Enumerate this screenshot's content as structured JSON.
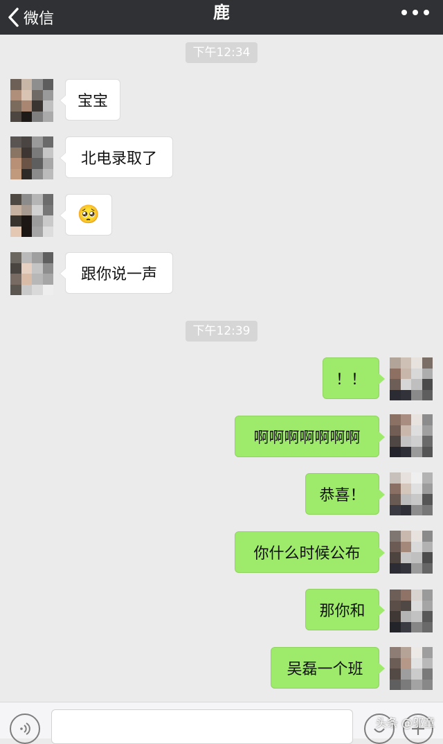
{
  "header": {
    "back_label": "微信",
    "title": "鹿",
    "more_icon": "more-dots-icon"
  },
  "timestamps": [
    "下午12:34",
    "下午12:39"
  ],
  "incoming": [
    {
      "text": "宝宝"
    },
    {
      "text": "北电录取了"
    },
    {
      "text": "🥺"
    },
    {
      "text": "跟你说一声"
    }
  ],
  "outgoing": [
    {
      "text": "！！"
    },
    {
      "text": "啊啊啊啊啊啊啊"
    },
    {
      "text": "恭喜！"
    },
    {
      "text": "你什么时候公布"
    },
    {
      "text": "那你和"
    },
    {
      "text": "吴磊一个班"
    }
  ],
  "inputbar": {
    "voice_icon": "voice-icon",
    "input_value": "",
    "emoji_icon": "emoji-icon",
    "plus_icon": "plus-icon"
  },
  "watermark": "头条 @邬童",
  "colors": {
    "topbar": "#2f3134",
    "background": "#ebebeb",
    "outgoing_bubble": "#9eea6a",
    "incoming_bubble": "#ffffff",
    "timestamp_bg": "#d6d6d6"
  }
}
